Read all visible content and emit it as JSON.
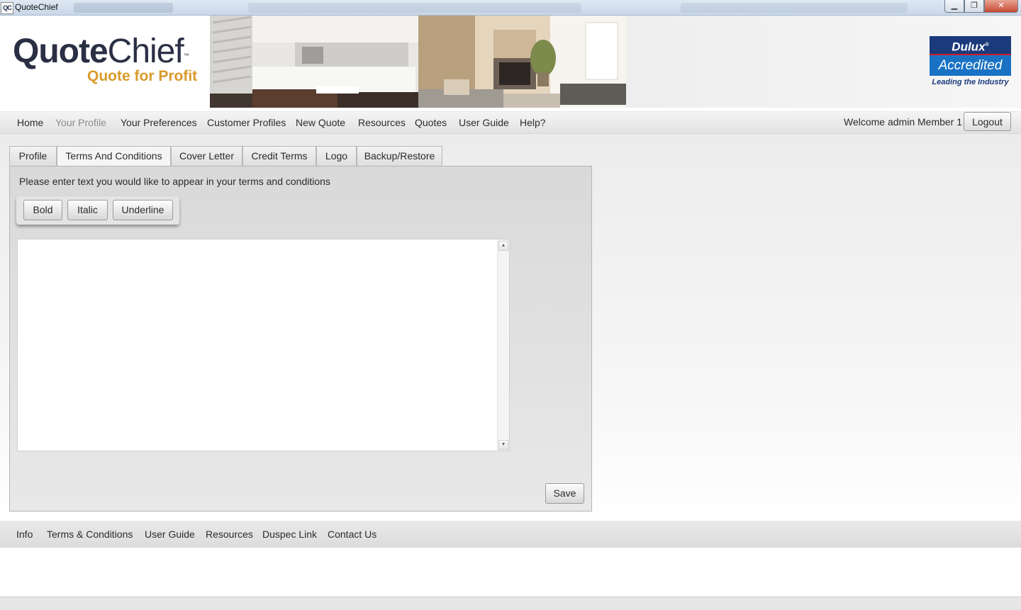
{
  "window": {
    "icon_text": "QC",
    "title": "QuoteChief",
    "minimize_glyph": "▁",
    "maximize_glyph": "❐",
    "close_glyph": "✕"
  },
  "header": {
    "logo_bold": "Quote",
    "logo_light": "Chief",
    "logo_tm": "™",
    "tagline": "Quote for Profit",
    "badge": {
      "brand": "Dulux",
      "brand_mark": "®",
      "status": "Accredited",
      "slogan": "Leading the Industry",
      "colors": {
        "navy": "#1a3a7c",
        "blue": "#1a72c4",
        "red": "#cc1f2b"
      }
    }
  },
  "nav": {
    "items": [
      {
        "label": "Home"
      },
      {
        "label": "Your Profile",
        "active": true
      },
      {
        "label": "Your Preferences"
      },
      {
        "label": "Customer Profiles"
      },
      {
        "label": "New Quote"
      },
      {
        "label": "Resources"
      },
      {
        "label": "Quotes"
      },
      {
        "label": "User Guide"
      },
      {
        "label": "Help?"
      }
    ],
    "welcome": "Welcome admin Member 1",
    "logout_label": "Logout"
  },
  "tabs": [
    {
      "label": "Profile"
    },
    {
      "label": "Terms And Conditions",
      "selected": true
    },
    {
      "label": "Cover Letter"
    },
    {
      "label": "Credit Terms"
    },
    {
      "label": "Logo"
    },
    {
      "label": "Backup/Restore"
    }
  ],
  "terms_panel": {
    "instruction": "Please enter text you would like to appear in your terms and conditions",
    "format_buttons": {
      "bold": "Bold",
      "italic": "Italic",
      "underline": "Underline"
    },
    "text_value": "",
    "save_label": "Save"
  },
  "footer": {
    "links": [
      {
        "label": "Info"
      },
      {
        "label": "Terms & Conditions"
      },
      {
        "label": "User Guide"
      },
      {
        "label": "Resources"
      },
      {
        "label": "Duspec Link"
      },
      {
        "label": "Contact Us"
      }
    ]
  }
}
